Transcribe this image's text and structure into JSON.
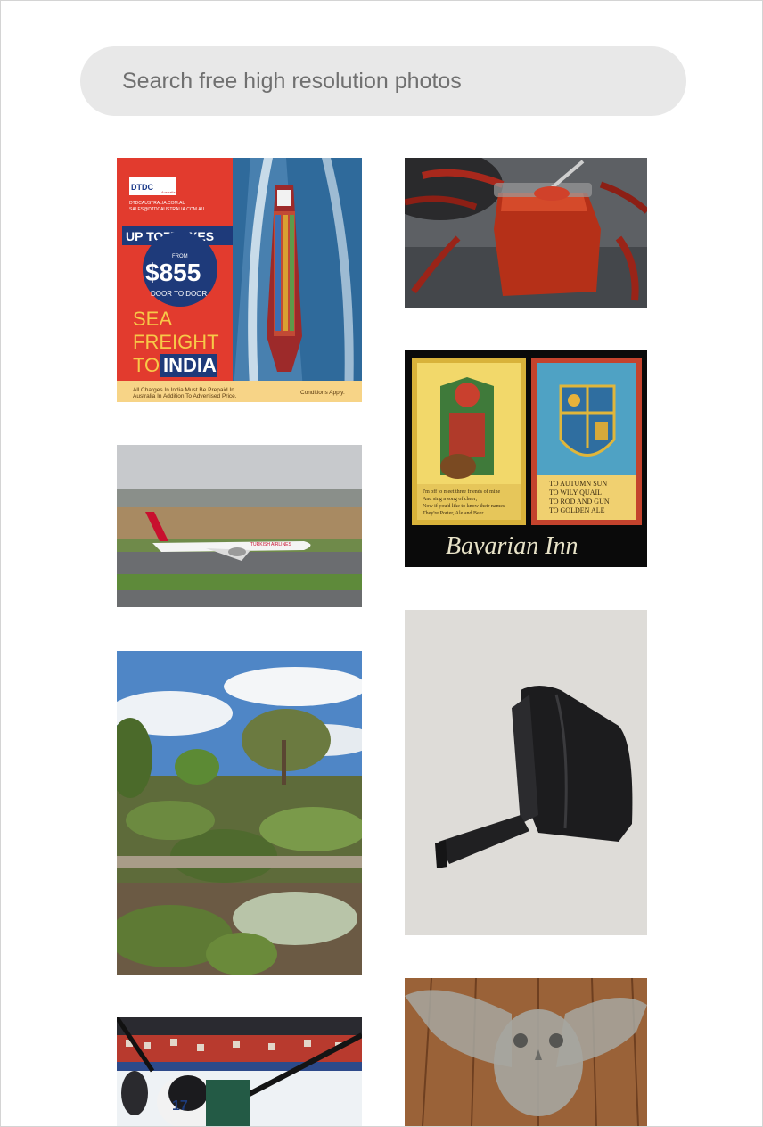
{
  "search": {
    "placeholder": "Search free high resolution photos"
  },
  "photos": [
    {
      "id": "shipping-ad",
      "ad": {
        "brand": "DTDC",
        "brand_sub": "Australia",
        "line1": "DTDCAUSTRALIA.COM.AU",
        "line2": "SALES@DTDCAUSTRALIA.COM.AU",
        "boxes": "UP TO7BOXES",
        "from": "FROM",
        "price": "$855",
        "door": "DOOR TO DOOR",
        "sea": "SEA",
        "freight": "FREIGHT",
        "to": "TO",
        "india": "INDIA",
        "footer1": "All Charges In India Must Be Prepaid In",
        "footer2": "Australia In Addition To Advertised Price.",
        "conditions": "Conditions Apply."
      }
    },
    {
      "id": "chili-jam"
    },
    {
      "id": "bavarian-inn",
      "caption": "Bavarian Inn",
      "left_verse": [
        "I'm off to meet three friends of mine",
        "And sing a song of cheer,",
        "Now if you'd like to know their names",
        "They're Porter, Ale and Beer."
      ],
      "right_verse": [
        "TO AUTUMN SUN",
        "TO WILY QUAIL",
        "TO ROD AND GUN",
        "TO GOLDEN ALE"
      ]
    },
    {
      "id": "airplane",
      "livery": "TURKISH AIRLINES"
    },
    {
      "id": "black-bracket"
    },
    {
      "id": "garden"
    },
    {
      "id": "hockey",
      "jersey": "17"
    },
    {
      "id": "wire-owl"
    }
  ]
}
